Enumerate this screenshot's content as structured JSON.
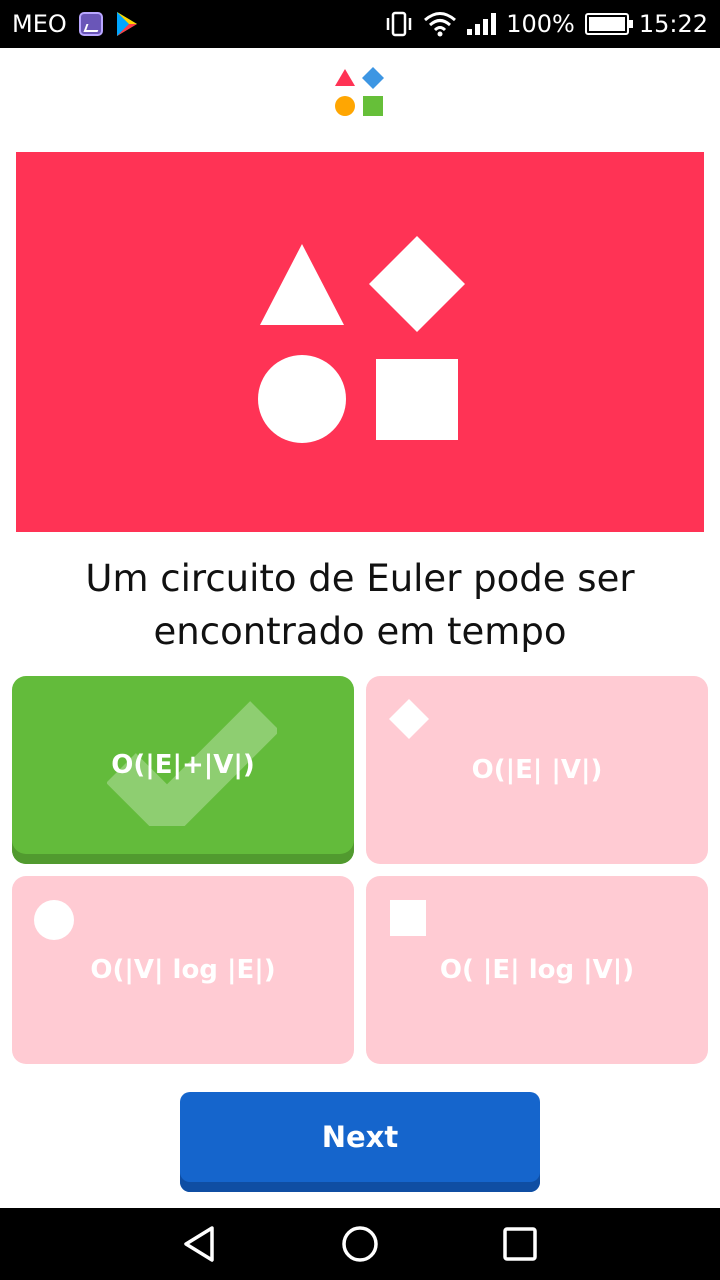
{
  "status_bar": {
    "carrier": "MEO",
    "battery": "100%",
    "time": "15:22",
    "icons": [
      "gallery-icon",
      "play-store-icon",
      "vibrate-icon",
      "wifi-icon",
      "signal-icon",
      "battery-icon"
    ]
  },
  "question": {
    "text": "Um circuito de Euler pode ser encontrado em tempo"
  },
  "answers": [
    {
      "label": "O(|E|+|V|)",
      "shape": "triangle",
      "state": "correct"
    },
    {
      "label": "O(|E| |V|)",
      "shape": "diamond",
      "state": "incorrect"
    },
    {
      "label": "O(|V| log |E|)",
      "shape": "circle",
      "state": "incorrect"
    },
    {
      "label": "O( |E| log |V|)",
      "shape": "square",
      "state": "incorrect"
    }
  ],
  "next_button": {
    "label": "Next"
  },
  "colors": {
    "hero_bg": "#ff3355",
    "correct_green": "#63bb3b",
    "incorrect_pink": "#ffcbd3",
    "next_blue": "#1565cc",
    "logo_triangle": "#ff3355",
    "logo_diamond": "#3d96e3",
    "logo_circle": "#ffa602",
    "logo_square": "#66bf39"
  }
}
